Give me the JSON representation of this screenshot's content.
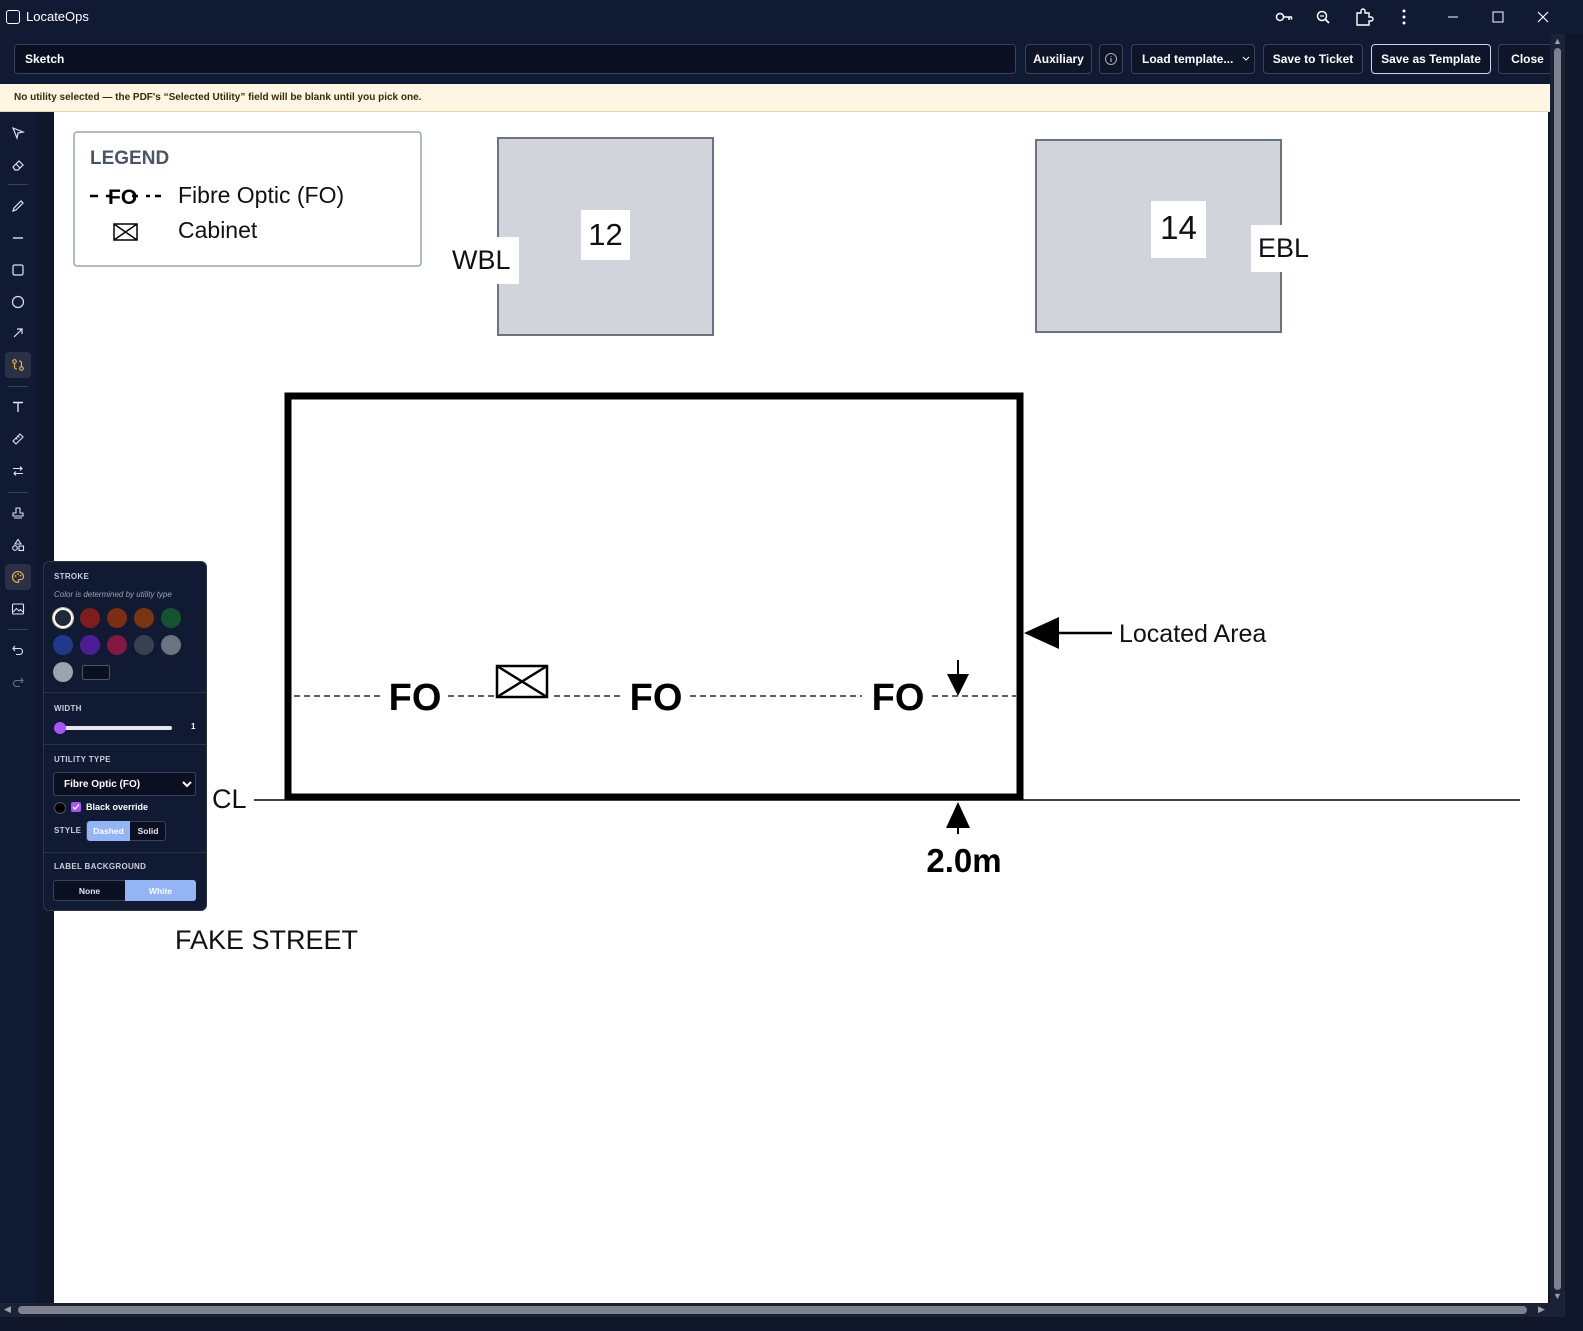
{
  "window": {
    "title": "LocateOps"
  },
  "toolbar": {
    "sketch_name": "Sketch",
    "auxiliary_label": "Auxiliary",
    "load_template_label": "Load template...",
    "save_ticket_label": "Save to Ticket",
    "save_template_label": "Save as Template",
    "close_label": "Close"
  },
  "warning": "No utility selected — the PDF's “Selected Utility” field will be blank until you pick one.",
  "tools": [
    "select",
    "eraser",
    "pencil",
    "line",
    "rectangle",
    "ellipse",
    "arrow",
    "utility-line",
    "text",
    "measure",
    "swap",
    "stamp",
    "shapes",
    "palette",
    "image",
    "undo",
    "redo"
  ],
  "stroke_panel": {
    "stroke_label": "STROKE",
    "stroke_note": "Color is determined by utility type",
    "colors": [
      "#1f2937",
      "#7f1d1d",
      "#7c2d12",
      "#78350f",
      "#14532d",
      "#1e3a8a",
      "#4c1d95",
      "#831843",
      "#374151",
      "#6b7280",
      "#9ca3af"
    ],
    "selected_color": "#1f2937",
    "width_label": "WIDTH",
    "width_value": "1",
    "width_fraction": 0.0,
    "utility_type_label": "UTILITY TYPE",
    "utility_type_value": "Fibre Optic (FO)",
    "black_override_label": "Black override",
    "black_override": true,
    "style_label": "STYLE",
    "style_dashed": "Dashed",
    "style_solid": "Solid",
    "style_selected": "Dashed",
    "label_background_label": "LABEL BACKGROUND",
    "bg_none": "None",
    "bg_white": "White",
    "bg_selected": "White"
  },
  "sketch": {
    "legend_title": "LEGEND",
    "legend_fo_symbol": "FO",
    "legend_fo_label": "Fibre Optic (FO)",
    "legend_cabinet_label": "Cabinet",
    "house_12": "12",
    "house_14": "14",
    "wbl": "WBL",
    "ebl": "EBL",
    "fo_label": "FO",
    "located_area": "Located Area",
    "cl": "CL",
    "dimension": "2.0m",
    "street": "FAKE STREET"
  }
}
